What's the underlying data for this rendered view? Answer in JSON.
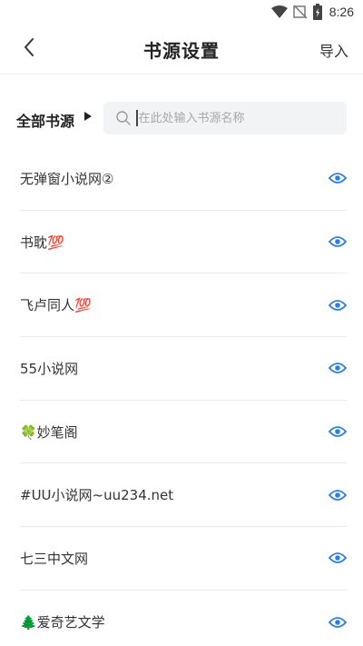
{
  "status_bar": {
    "time": "8:26",
    "icons": [
      "wifi-icon",
      "signal-off-icon",
      "battery-charging-icon"
    ]
  },
  "app_bar": {
    "back_icon": "chevron-left-icon",
    "title": "书源设置",
    "import_label": "导入"
  },
  "filter": {
    "label": "全部书源",
    "arrow_icon": "triangle-right-icon"
  },
  "search": {
    "icon": "search-icon",
    "placeholder": "在此处输入书源名称",
    "value": ""
  },
  "sources": [
    {
      "name": "无弹窗小说网②",
      "visibility_icon": "eye-icon"
    },
    {
      "name": "书耽💯",
      "visibility_icon": "eye-icon"
    },
    {
      "name": "飞卢同人💯",
      "visibility_icon": "eye-icon"
    },
    {
      "name": "55小说网",
      "visibility_icon": "eye-icon"
    },
    {
      "name": "🍀妙笔阁",
      "visibility_icon": "eye-icon"
    },
    {
      "name": "#UU小说网~uu234.net",
      "visibility_icon": "eye-icon"
    },
    {
      "name": "七三中文网",
      "visibility_icon": "eye-icon"
    },
    {
      "name": "🌲爱奇艺文学",
      "visibility_icon": "eye-icon"
    }
  ],
  "colors": {
    "accent": "#2b7de9",
    "search_bg": "#f2f3f5",
    "divider": "#ebebeb",
    "text": "#333333"
  }
}
